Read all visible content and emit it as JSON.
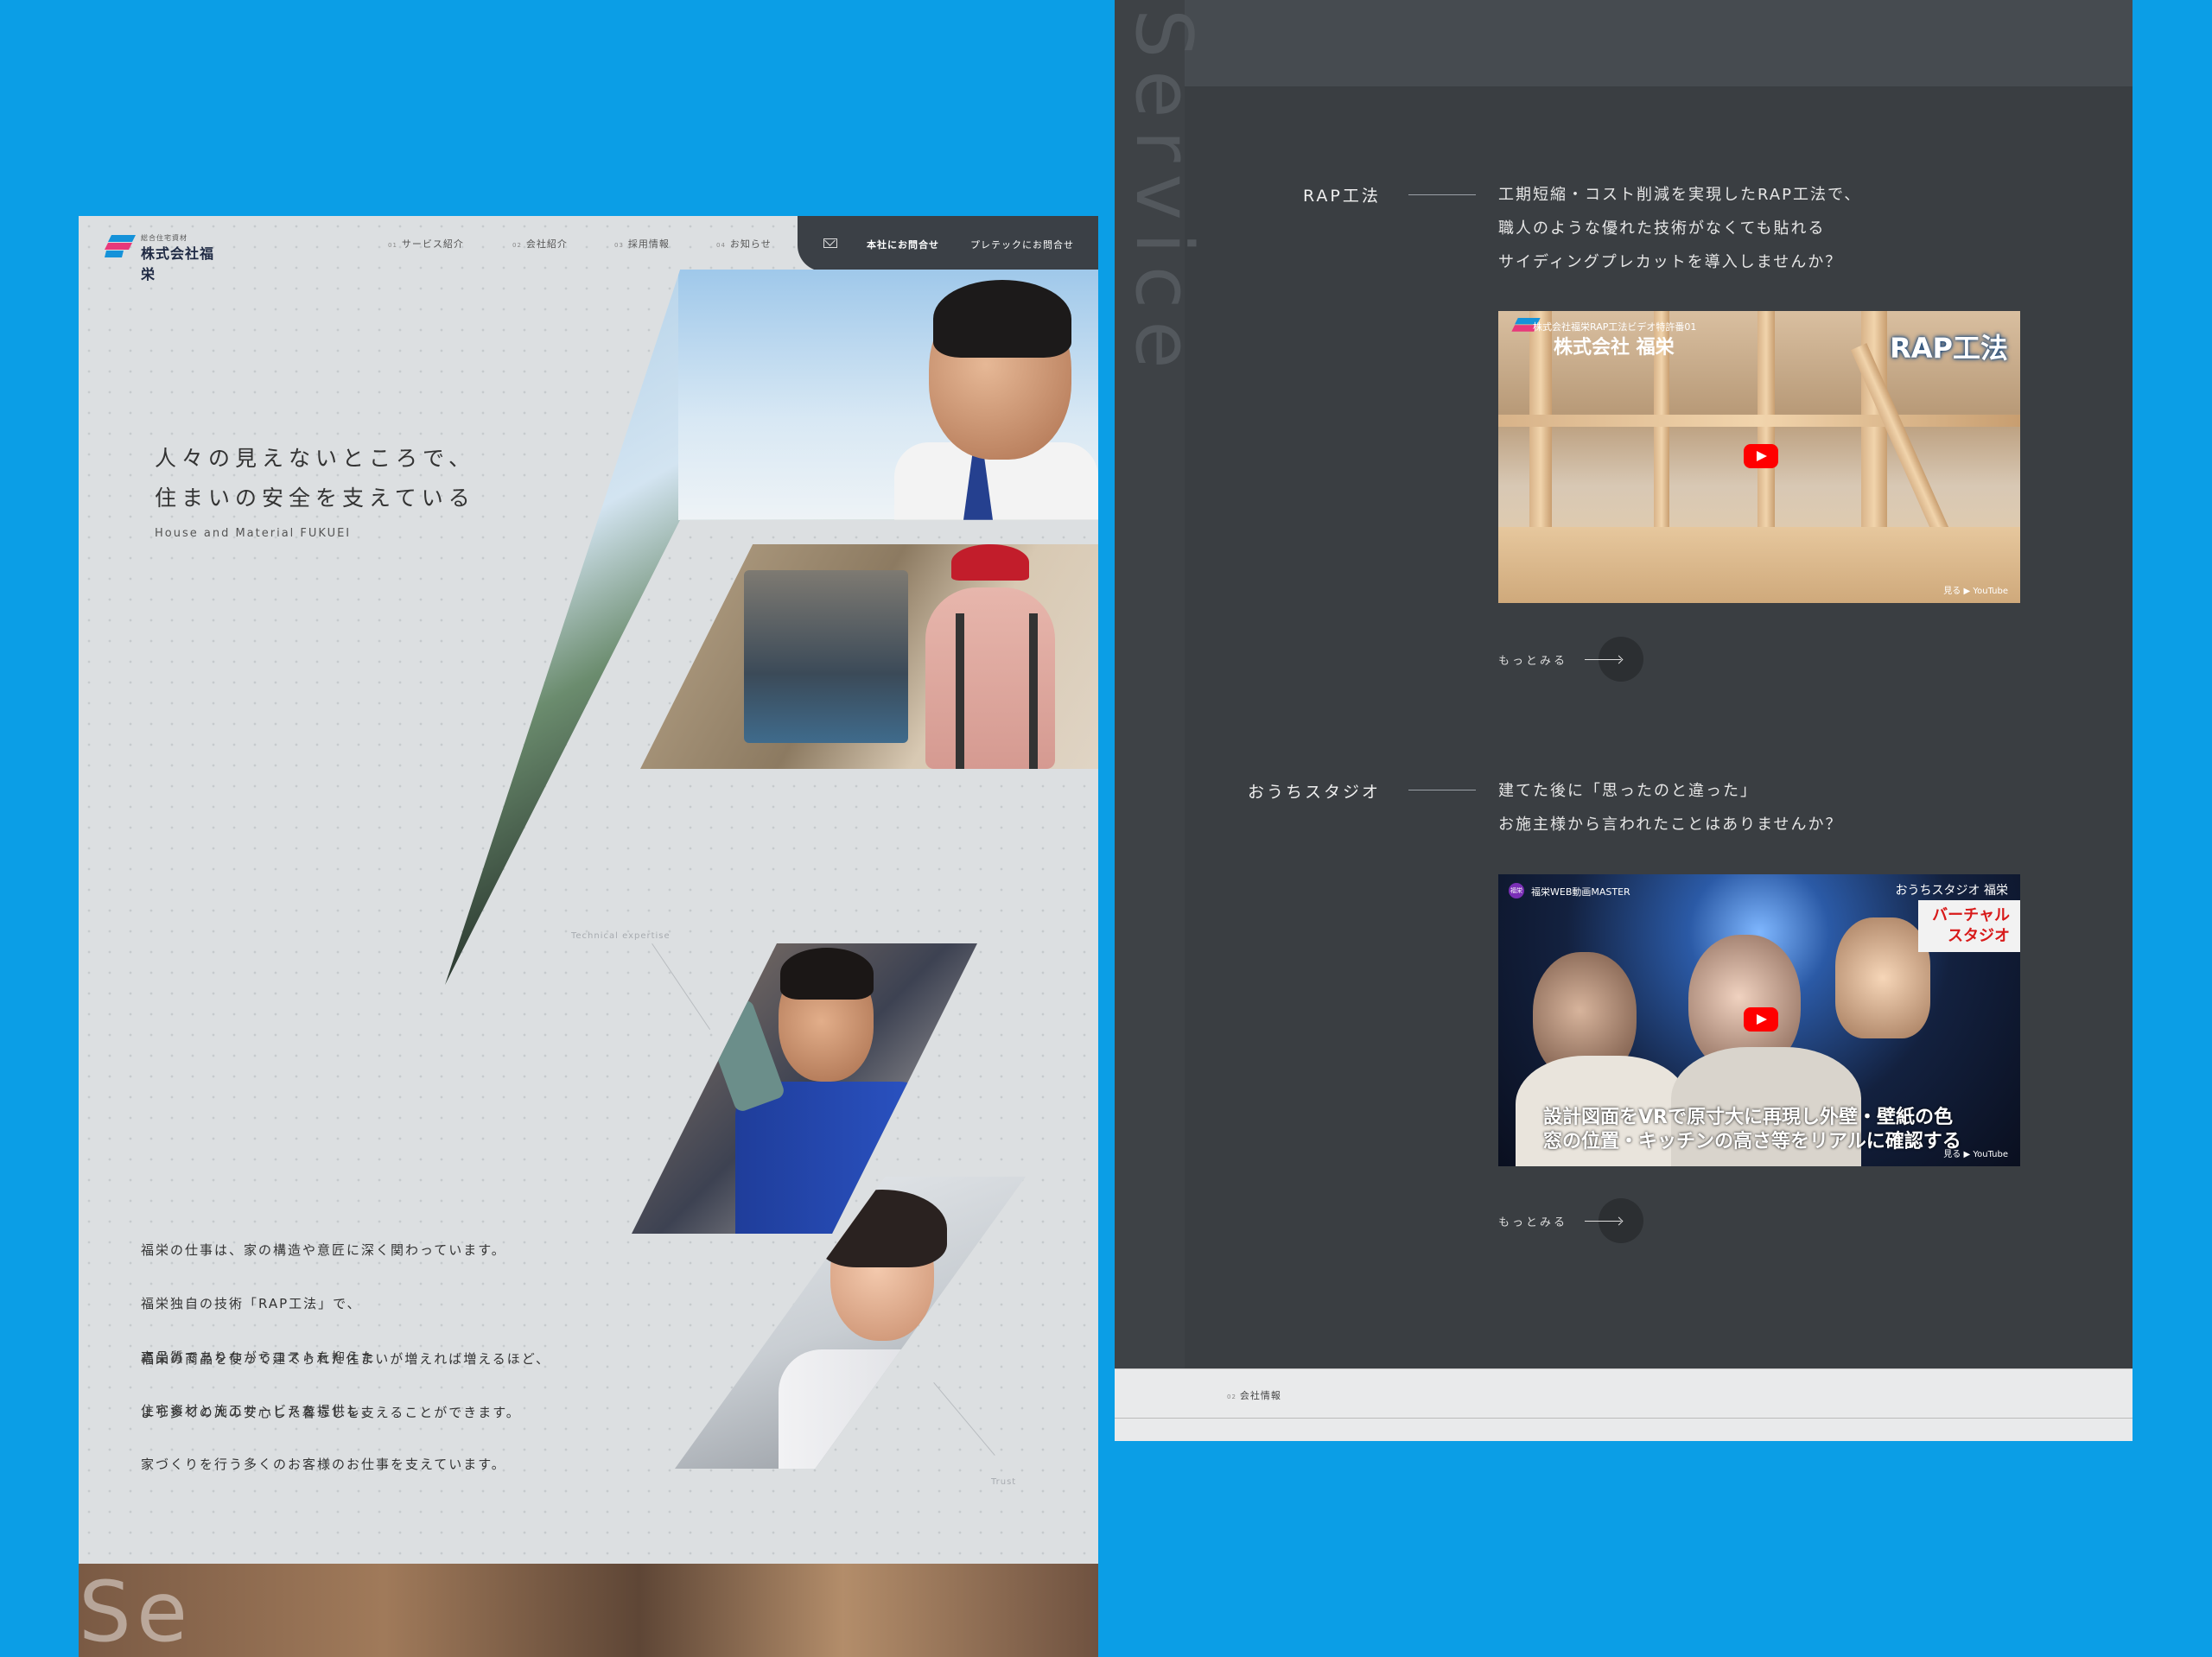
{
  "left": {
    "logo": {
      "sub": "総合住宅資材",
      "name": "株式会社福栄"
    },
    "nav": [
      {
        "num": "01",
        "label": "サービス紹介"
      },
      {
        "num": "02",
        "label": "会社紹介"
      },
      {
        "num": "03",
        "label": "採用情報"
      },
      {
        "num": "04",
        "label": "お知らせ"
      }
    ],
    "contact": {
      "primary": "本社にお問合せ",
      "secondary": "プレテックにお問合せ"
    },
    "hero": {
      "line1": "人々の見えないところで、",
      "line2": "住まいの安全を支えている",
      "sub": "House and Material FUKUEI"
    },
    "labels": {
      "expertise": "Technical expertise",
      "trust": "Trust"
    },
    "body1": [
      "福栄の仕事は、家の構造や意匠に深く関わっています。",
      "福栄独自の技術「RAP工法」で、",
      "高品質でありながらコストを抑えた",
      "住宅資材と施工サービスを提供し、",
      "家づくりを行う多くのお客様のお仕事を支えています。"
    ],
    "body2": [
      "福栄の商品を使って建てられた住まいが増えれば増えるほど、",
      "より多くの人の安心した暮らしを支えることができます。"
    ],
    "strip_word": "Se"
  },
  "right": {
    "vertical_word": "Service",
    "sections": [
      {
        "label": "RAP工法",
        "desc": [
          "工期短縮・コスト削減を実現したRAP工法で、",
          "職人のような優れた技術がなくても貼れる",
          "サイディングプレカットを導入しませんか？"
        ],
        "video": {
          "channel": "株式会社福栄RAP工法ビデオ特許番01",
          "title": "株式会社 福栄",
          "badge": "RAP工法",
          "yt": "見る ▶ YouTube"
        },
        "more": "もっとみる"
      },
      {
        "label": "おうちスタジオ",
        "desc": [
          "建てた後に「思ったのと違った」",
          "お施主様から言われたことはありませんか？"
        ],
        "video": {
          "badge_short": "福栄",
          "channel": "福栄WEB動画MASTER",
          "top_right": "おうちスタジオ 福栄",
          "banner_1": "バーチャル",
          "banner_2": "スタジオ",
          "caption_1": "設計図面をVRで原寸大に再現し外壁・壁紙の色",
          "caption_2": "窓の位置・キッチンの高さ等をリアルに確認する",
          "yt": "見る ▶ YouTube"
        },
        "more": "もっとみる"
      }
    ],
    "footer": {
      "num": "02",
      "label": "会社情報"
    }
  }
}
